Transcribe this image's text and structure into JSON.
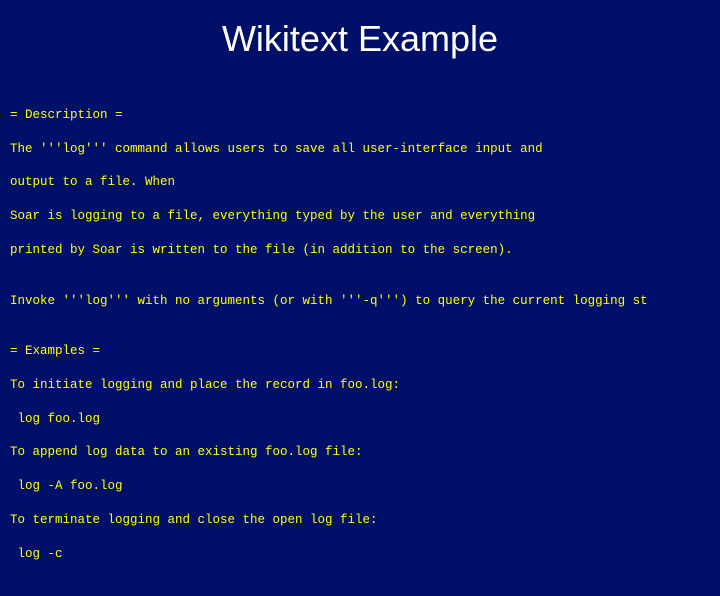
{
  "title": "Wikitext Example",
  "lines": {
    "l1": "= Description =",
    "l2": "The '''log''' command allows users to save all user-interface input and",
    "l3": "output to a file. When",
    "l4": "Soar is logging to a file, everything typed by the user and everything",
    "l5": "printed by Soar is written to the file (in addition to the screen).",
    "l6": "",
    "l7": "Invoke '''log''' with no arguments (or with '''-q''') to query the current logging st",
    "l8": "",
    "l9": "= Examples =",
    "l10": "To initiate logging and place the record in foo.log:",
    "l11": " log foo.log",
    "l12": "To append log data to an existing foo.log file:",
    "l13": " log -A foo.log",
    "l14": "To terminate logging and close the open log file:",
    "l15": " log -c"
  }
}
